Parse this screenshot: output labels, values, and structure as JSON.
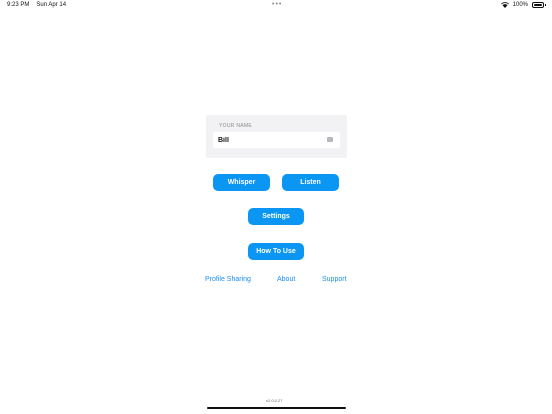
{
  "status_bar": {
    "time": "9:23 PM",
    "date": "Sun Apr 14",
    "dots": "•••",
    "battery": "100%"
  },
  "name_card": {
    "label": "YOUR NAME",
    "value": "Bill"
  },
  "buttons": {
    "whisper": "Whisper",
    "listen": "Listen",
    "settings": "Settings",
    "how_to_use": "How To Use"
  },
  "links": {
    "profile_sharing": "Profile Sharing",
    "about": "About",
    "support": "Support"
  },
  "footer": {
    "version": "v2.0.0.27"
  },
  "colors": {
    "accent": "#0a96f2",
    "link": "#1a8ff0",
    "card_bg": "#f2f2f4"
  }
}
